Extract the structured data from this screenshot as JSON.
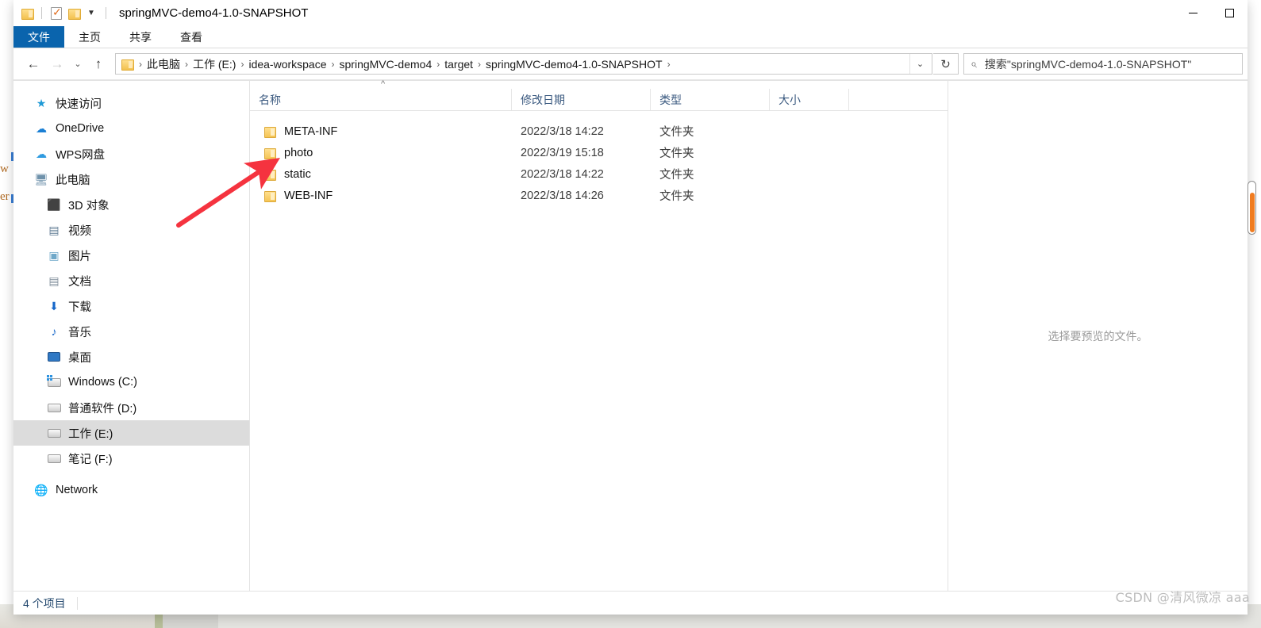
{
  "window": {
    "title": "springMVC-demo4-1.0-SNAPSHOT",
    "quick_access": [
      {
        "name": "folder-icon",
        "label": "文件夹"
      },
      {
        "name": "properties-icon",
        "label": "属性"
      },
      {
        "name": "new-folder-icon",
        "label": "新建文件夹"
      },
      {
        "name": "customize-chevron-icon",
        "label": "自定义快速访问工具栏"
      }
    ],
    "controls": {
      "minimize": "最小化",
      "maximize": "最大化"
    }
  },
  "ribbon": {
    "tabs": [
      {
        "label": "文件",
        "active": true
      },
      {
        "label": "主页",
        "active": false
      },
      {
        "label": "共享",
        "active": false
      },
      {
        "label": "查看",
        "active": false
      }
    ]
  },
  "navbar": {
    "back": "←",
    "forward": "→",
    "recent": "⌄",
    "up": "↑",
    "breadcrumbs": [
      "此电脑",
      "工作 (E:)",
      "idea-workspace",
      "springMVC-demo4",
      "target",
      "springMVC-demo4-1.0-SNAPSHOT"
    ],
    "separator": "›",
    "address_dropdown": "⌄",
    "refresh": "↻",
    "search_placeholder": "搜索\"springMVC-demo4-1.0-SNAPSHOT\"",
    "search_icon": "⌕"
  },
  "navpane": {
    "items": [
      {
        "label": "快速访问",
        "icon": "star-icon",
        "indent": false,
        "selected": false
      },
      {
        "label": "OneDrive",
        "icon": "cloud-icon",
        "indent": false,
        "selected": false
      },
      {
        "label": "WPS网盘",
        "icon": "wps-cloud-icon",
        "indent": false,
        "selected": false
      },
      {
        "label": "此电脑",
        "icon": "this-pc-icon",
        "indent": false,
        "selected": false
      },
      {
        "label": "3D 对象",
        "icon": "3d-objects-icon",
        "indent": true,
        "selected": false
      },
      {
        "label": "视频",
        "icon": "videos-icon",
        "indent": true,
        "selected": false
      },
      {
        "label": "图片",
        "icon": "pictures-icon",
        "indent": true,
        "selected": false
      },
      {
        "label": "文档",
        "icon": "documents-icon",
        "indent": true,
        "selected": false
      },
      {
        "label": "下载",
        "icon": "downloads-icon",
        "indent": true,
        "selected": false
      },
      {
        "label": "音乐",
        "icon": "music-icon",
        "indent": true,
        "selected": false
      },
      {
        "label": "桌面",
        "icon": "desktop-icon",
        "indent": true,
        "selected": false
      },
      {
        "label": "Windows (C:)",
        "icon": "system-drive-icon",
        "indent": true,
        "selected": false
      },
      {
        "label": "普通软件 (D:)",
        "icon": "drive-icon",
        "indent": true,
        "selected": false
      },
      {
        "label": "工作 (E:)",
        "icon": "drive-icon",
        "indent": true,
        "selected": true
      },
      {
        "label": "笔记 (F:)",
        "icon": "drive-icon",
        "indent": true,
        "selected": false
      },
      {
        "label": "Network",
        "icon": "network-icon",
        "indent": false,
        "selected": false
      }
    ]
  },
  "filelist": {
    "sort_indicator": "^",
    "columns": [
      "名称",
      "修改日期",
      "类型",
      "大小"
    ],
    "rows": [
      {
        "name": "META-INF",
        "date": "2022/3/18 14:22",
        "type": "文件夹",
        "size": ""
      },
      {
        "name": "photo",
        "date": "2022/3/19 15:18",
        "type": "文件夹",
        "size": ""
      },
      {
        "name": "static",
        "date": "2022/3/18 14:22",
        "type": "文件夹",
        "size": ""
      },
      {
        "name": "WEB-INF",
        "date": "2022/3/18 14:26",
        "type": "文件夹",
        "size": ""
      }
    ]
  },
  "preview": {
    "message": "选择要预览的文件。"
  },
  "statusbar": {
    "item_count": "4 个项目"
  },
  "annotations": {
    "arrow_color": "#f5333f",
    "arrow_target": "photo",
    "watermark": "CSDN @清风微凉 aaa"
  },
  "background": {
    "text_fragments": [
      "w",
      "er"
    ],
    "accent": "#f07c20"
  }
}
